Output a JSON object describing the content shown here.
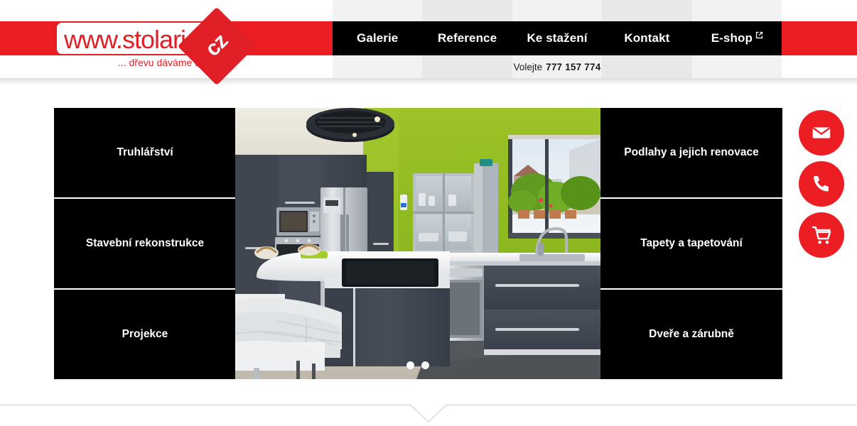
{
  "site": {
    "logo": {
      "main_text": "www.stolari.",
      "badge_text": "cz",
      "tagline": "... dřevu dáváme tvar",
      "brand_red": "#ec1e24"
    }
  },
  "nav": {
    "items": [
      {
        "label": "Galerie",
        "external": false
      },
      {
        "label": "Reference",
        "external": false
      },
      {
        "label": "Ke stažení",
        "external": false
      },
      {
        "label": "Kontakt",
        "external": false
      },
      {
        "label": "E-shop",
        "external": true
      }
    ]
  },
  "contact": {
    "call_label": "Volejte",
    "phone": "777 157 774"
  },
  "hero": {
    "left_tiles": [
      {
        "label": "Truhlářství"
      },
      {
        "label": "Stavební rekonstrukce"
      },
      {
        "label": "Projekce"
      }
    ],
    "right_tiles": [
      {
        "label": "Podlahy a jejich renovace"
      },
      {
        "label": "Tapety a tapetování"
      },
      {
        "label": "Dveře a zárubně"
      }
    ],
    "slider": {
      "slide_count": 2,
      "active_index": 0,
      "image_alt": "Moderní kuchyně"
    }
  },
  "fabs": [
    {
      "icon": "email-icon"
    },
    {
      "icon": "phone-icon"
    },
    {
      "icon": "cart-icon"
    }
  ],
  "colors": {
    "brand_red": "#ec1e24",
    "nav_black": "#000000",
    "band_light": "#f2f2f2",
    "band_dark": "#e8e8e8",
    "divider_gray": "#cccccc"
  }
}
